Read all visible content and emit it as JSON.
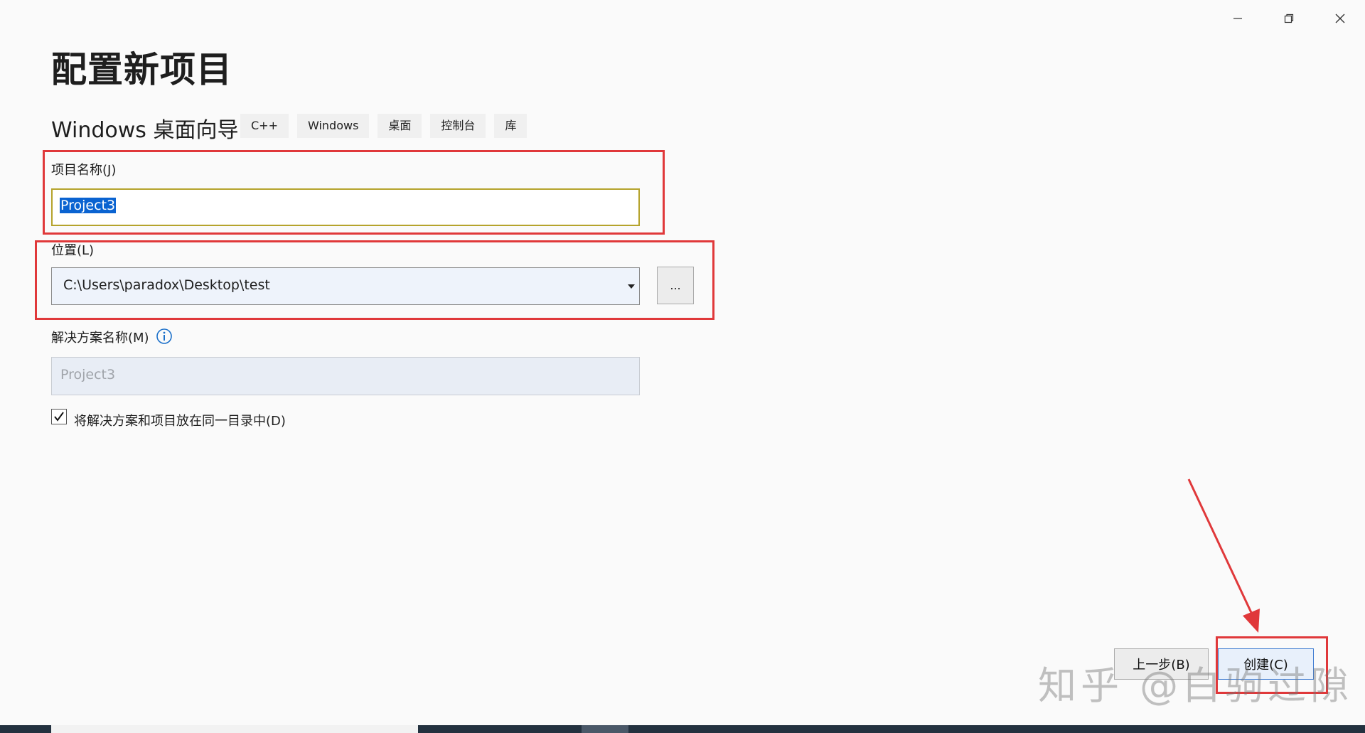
{
  "window": {
    "title": "配置新项目",
    "controls": {
      "minimize_icon": "minimize-icon",
      "restore_icon": "restore-icon",
      "close_icon": "close-icon"
    }
  },
  "template": {
    "name": "Windows 桌面向导",
    "tags": [
      "C++",
      "Windows",
      "桌面",
      "控制台",
      "库"
    ]
  },
  "form": {
    "project_name": {
      "label": "项目名称(J)",
      "value": "Project3"
    },
    "location": {
      "label": "位置(L)",
      "value": "C:\\Users\\paradox\\Desktop\\test",
      "browse_label": "..."
    },
    "solution_name": {
      "label": "解决方案名称(M)",
      "placeholder": "Project3"
    },
    "same_directory": {
      "label": "将解决方案和项目放在同一目录中(D)",
      "checked": true
    }
  },
  "footer": {
    "back_label": "上一步(B)",
    "create_label": "创建(C)"
  },
  "watermark": "知乎 @白驹过隙",
  "colors": {
    "annotation_red": "#e0383a",
    "selection_blue": "#0a63d1",
    "focus_border": "#b5a32c"
  }
}
